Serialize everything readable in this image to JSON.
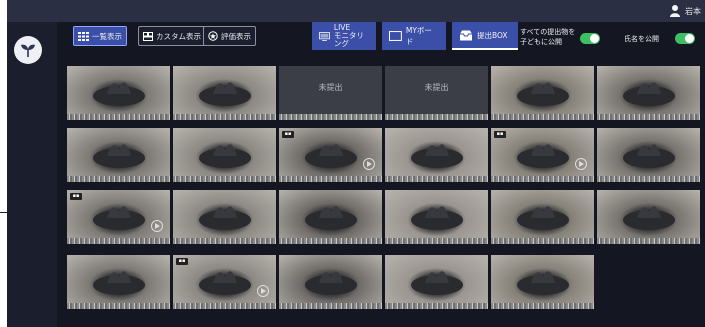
{
  "user": {
    "name": "岩本"
  },
  "toolbar": {
    "view_list_label": "一覧表示",
    "view_custom_label": "カスタム表示",
    "view_eval_label": "評価表示",
    "live_label_1": "LIVE",
    "live_label_2": "モニタリング",
    "myboard_label": "MYボード",
    "submit_box_label": "提出BOX",
    "toggle_public_label_1": "すべての提出物を",
    "toggle_public_label_2": "子どもに公開",
    "toggle_names_label": "氏名を公開"
  },
  "toggles": {
    "public_all": true,
    "show_names": true
  },
  "gallery": {
    "tiles": [
      {
        "status": "submitted",
        "video": false
      },
      {
        "status": "submitted",
        "video": false
      },
      {
        "status": "not_submitted",
        "text": "未提出"
      },
      {
        "status": "not_submitted",
        "text": "未提出"
      },
      {
        "status": "submitted",
        "video": false
      },
      {
        "status": "submitted",
        "video": false
      },
      {
        "status": "submitted",
        "video": false
      },
      {
        "status": "submitted",
        "video": false
      },
      {
        "status": "submitted",
        "video": true
      },
      {
        "status": "submitted",
        "video": false
      },
      {
        "status": "submitted",
        "video": true
      },
      {
        "status": "submitted",
        "video": false
      },
      {
        "status": "submitted",
        "video": true
      },
      {
        "status": "submitted",
        "video": false
      },
      {
        "status": "submitted",
        "video": false
      },
      {
        "status": "submitted",
        "video": false
      },
      {
        "status": "submitted",
        "video": false
      },
      {
        "status": "submitted",
        "video": false
      },
      {
        "status": "submitted",
        "video": false
      },
      {
        "status": "submitted",
        "video": true
      },
      {
        "status": "submitted",
        "video": false
      },
      {
        "status": "submitted",
        "video": false
      },
      {
        "status": "submitted",
        "video": false
      }
    ]
  },
  "colors": {
    "accent": "#3b4fa8",
    "toggle_on": "#3fbf63",
    "background": "#141722"
  }
}
